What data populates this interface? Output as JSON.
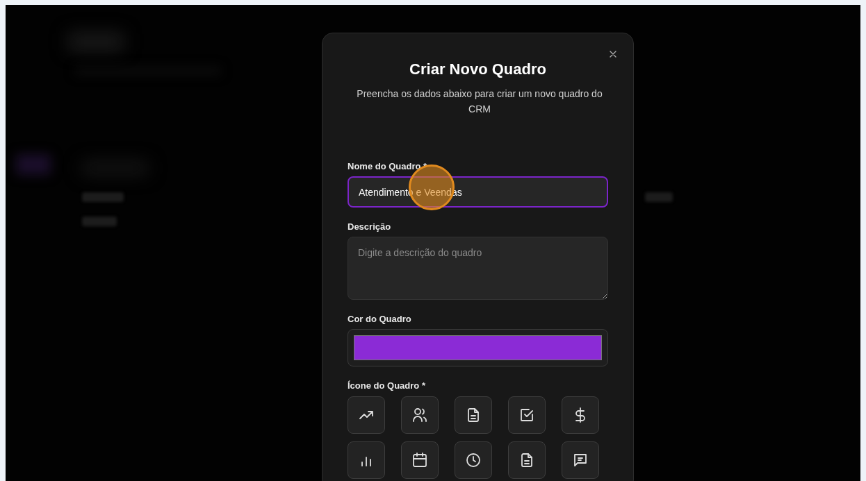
{
  "dialog": {
    "title": "Criar Novo Quadro",
    "subtitle": "Preencha os dados abaixo para criar um novo quadro do CRM"
  },
  "fields": [
    {
      "kind": "text",
      "label": "Nome do Quadro *",
      "value": "Atendimento e Veendas",
      "focused": true
    },
    {
      "kind": "textarea",
      "label": "Descrição",
      "placeholder": "Digite a descrição do quadro"
    },
    {
      "kind": "color",
      "label": "Cor do Quadro",
      "color": "#8b2bd6"
    }
  ],
  "icon_picker": {
    "label": "Ícone do Quadro *",
    "options": [
      {
        "kind": "trending-up",
        "selected": false
      },
      {
        "kind": "users",
        "selected": false
      },
      {
        "kind": "document",
        "selected": false
      },
      {
        "kind": "checkbox",
        "selected": false
      },
      {
        "kind": "dollar",
        "selected": false
      },
      {
        "kind": "bar-chart",
        "selected": false
      },
      {
        "kind": "calendar",
        "selected": false
      },
      {
        "kind": "clock",
        "selected": false
      },
      {
        "kind": "document",
        "selected": false
      },
      {
        "kind": "message",
        "selected": false
      }
    ]
  }
}
